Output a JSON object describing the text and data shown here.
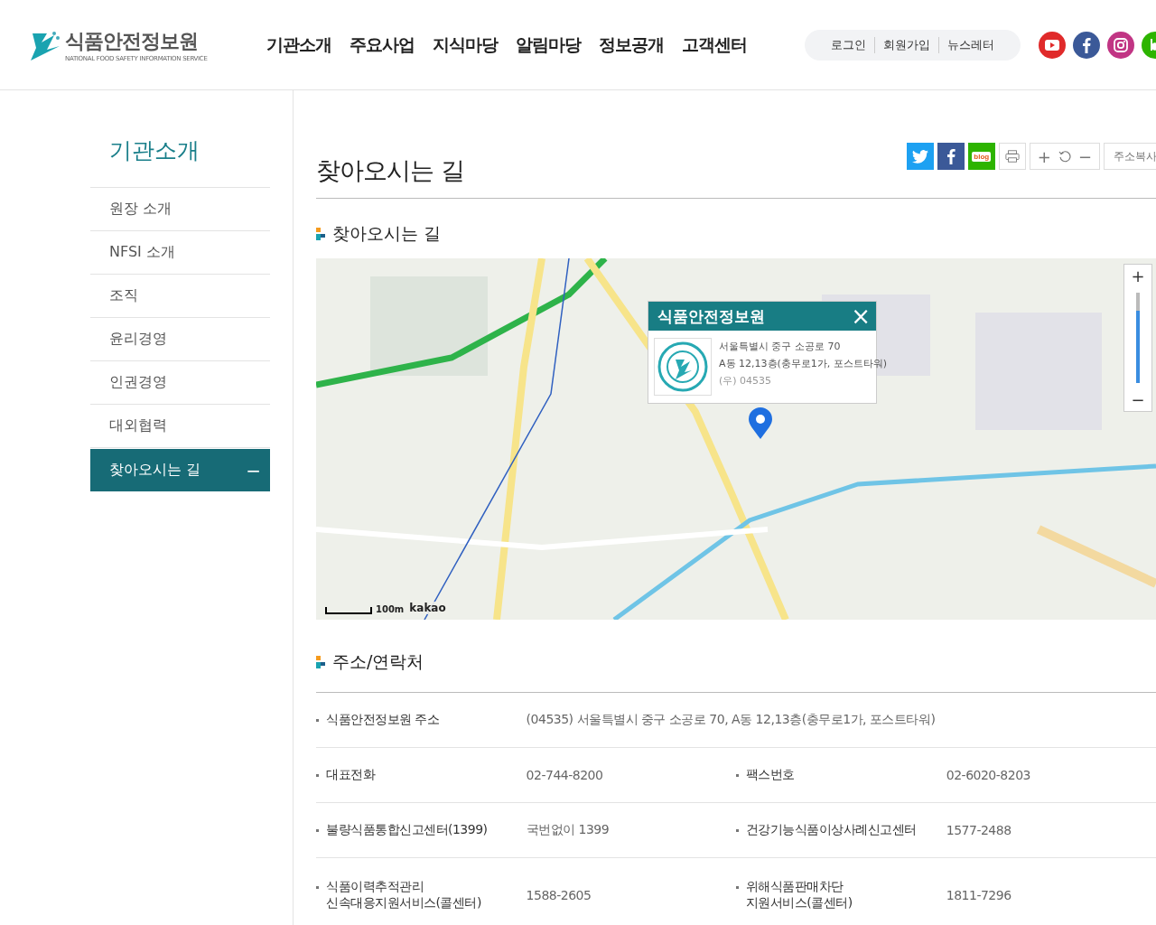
{
  "header": {
    "logo_title": "식품안전정보원",
    "logo_subtitle": "NATIONAL FOOD SAFETY INFORMATION SERVICE",
    "nav": [
      "기관소개",
      "주요사업",
      "지식마당",
      "알림마당",
      "정보공개",
      "고객센터"
    ],
    "util_links": [
      "로그인",
      "회원가입",
      "뉴스레터"
    ],
    "social": [
      {
        "kind": "youtube",
        "color": "#e02a2a"
      },
      {
        "kind": "facebook",
        "color": "#3b5998"
      },
      {
        "kind": "instagram",
        "color": "#c13584"
      },
      {
        "kind": "blog",
        "color": "#2db400"
      }
    ]
  },
  "sidebar": {
    "title": "기관소개",
    "items": [
      {
        "label": "원장 소개",
        "selected": false
      },
      {
        "label": "NFSI 소개",
        "selected": false
      },
      {
        "label": "조직",
        "selected": false
      },
      {
        "label": "윤리경영",
        "selected": false
      },
      {
        "label": "인권경영",
        "selected": false
      },
      {
        "label": "대외협력",
        "selected": false
      },
      {
        "label": "찾아오시는 길",
        "selected": true,
        "toggle": "−"
      }
    ]
  },
  "page_title": "찾아오시는 길",
  "toolbar": {
    "share": [
      {
        "kind": "twitter"
      },
      {
        "kind": "facebook"
      },
      {
        "kind": "blog",
        "label": "blog"
      }
    ],
    "zoom_in": "+",
    "zoom_out": "−",
    "copy_url": "주소복사"
  },
  "map_section": {
    "heading": "찾아오시는 길",
    "popup": {
      "title": "식품안전정보원",
      "close": "×",
      "address_line1": "서울특별시 중구 소공로 70",
      "address_line2": "A동 12,13층(충무로1가, 포스트타워)",
      "postal": "(우) 04535"
    },
    "scale": "100m",
    "brand": "kakao",
    "zoom_in": "+",
    "zoom_out": "−",
    "zoom_slider": {
      "level": 0.8
    }
  },
  "contact_section": {
    "heading": "주소/연락처",
    "rows": [
      [
        {
          "label": "식품안전정보원 주소",
          "value": "(04535) 서울특별시 중구 소공로 70, A동 12,13층(충무로1가, 포스트타워)"
        }
      ],
      [
        {
          "label": "대표전화",
          "value": "02-744-8200"
        },
        {
          "label": "팩스번호",
          "value": "02-6020-8203"
        }
      ],
      [
        {
          "label": "불량식품통합신고센터(1399)",
          "value": "국번없이 1399"
        },
        {
          "label": "건강기능식품이상사례신고센터",
          "value": "1577-2488"
        }
      ],
      [
        {
          "label": "식품이력추적관리\n신속대응지원서비스(콜센터)",
          "value": "1588-2605"
        },
        {
          "label": "위해식품판매차단\n지원서비스(콜센터)",
          "value": "1811-7296"
        }
      ]
    ]
  }
}
